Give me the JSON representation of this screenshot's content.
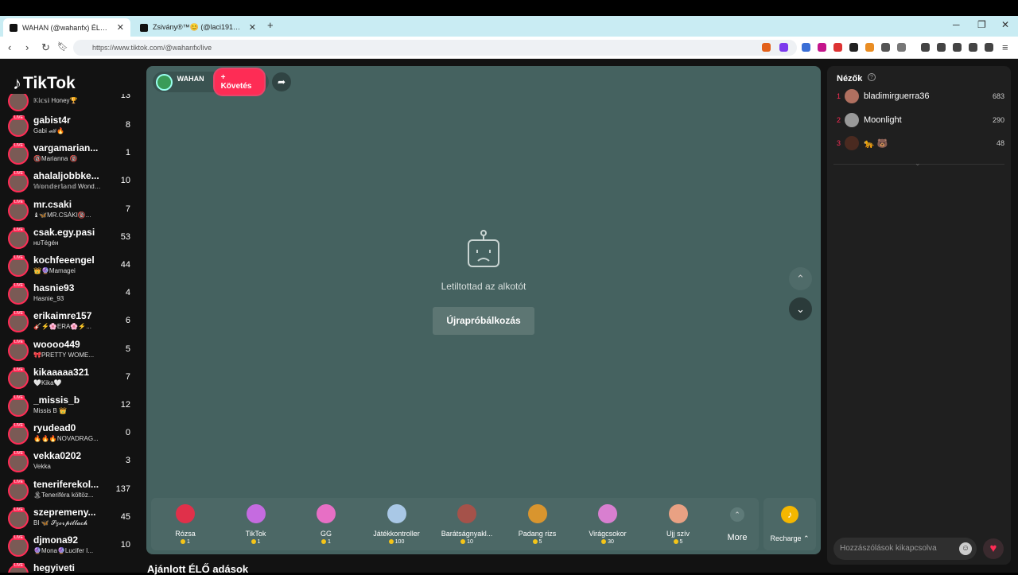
{
  "browser": {
    "tabs": [
      {
        "title": "WAHAN (@wahanfx) ÉLŐ adásb",
        "close": "✕"
      },
      {
        "title": "Zsivány®™😊 (@laci1910) ÉLŐ a",
        "close": "✕"
      }
    ],
    "new_tab": "+",
    "url": "https://www.tiktok.com/@wahanfx/live"
  },
  "brand": "TikTok",
  "sidebar": {
    "partial_top": {
      "sub": "𝕂𝕚𝕔𝕤𝕚 Honey🏆",
      "count": "13"
    },
    "items": [
      {
        "name": "gabist4r",
        "sub": "Gabi 🏎🔥",
        "count": "8"
      },
      {
        "name": "vargamarian...",
        "sub": "🔞Marianna 🔞",
        "count": "1"
      },
      {
        "name": "ahalaljobbke...",
        "sub": "𝕎𝕠𝕟𝕕𝕖𝕣𝕝𝕒𝕟𝕕 Wonderland_...",
        "count": "10"
      },
      {
        "name": "mr.csaki",
        "sub": "♝🦋MR.CSÁKI🔞...",
        "count": "7"
      },
      {
        "name": "csak.egy.pasi",
        "sub": "ʜᴜTégéʜ",
        "count": "53"
      },
      {
        "name": "kochfeeengel",
        "sub": "👑🔮Mamagei",
        "count": "44"
      },
      {
        "name": "hasnie93",
        "sub": "Hasnie_93",
        "count": "4"
      },
      {
        "name": "erikaimre157",
        "sub": "🎸⚡🌸ERA🌸⚡...",
        "count": "6"
      },
      {
        "name": "woooo449",
        "sub": "🎀PRETTY WOME...",
        "count": "5"
      },
      {
        "name": "kikaaaaa321",
        "sub": "🤍Kika🤍",
        "count": "7"
      },
      {
        "name": "_missis_b",
        "sub": "Missis B 👑",
        "count": "12"
      },
      {
        "name": "ryudead0",
        "sub": "🔥🔥🔥NOVADRAG...",
        "count": "0"
      },
      {
        "name": "vekka0202",
        "sub": "Vekka",
        "count": "3"
      },
      {
        "name": "teneriferekol...",
        "sub": "🏝Teneriféra költöz...",
        "count": "137"
      },
      {
        "name": "szepremeny...",
        "sub": "BI 🦋 𝓢𝔃𝓸𝓻𝓹𝓲𝓵𝓵𝓪𝓬𝓱",
        "count": "45"
      },
      {
        "name": "djmona92",
        "sub": "🔮Mona🔮Lucifer I...",
        "count": "10"
      },
      {
        "name": "hegyiveti",
        "sub": "",
        "count": ""
      }
    ]
  },
  "player": {
    "host_name": "WAHAN",
    "follow_label": "+ Követés",
    "message": "Letiltottad az alkotót",
    "retry_label": "Újrapróbálkozás",
    "up_icon": "⌃",
    "down_icon": "⌄"
  },
  "gifts": [
    {
      "name": "Rózsa",
      "price": "1",
      "color": "#e0304a"
    },
    {
      "name": "TikTok",
      "price": "1",
      "color": "#c56be0"
    },
    {
      "name": "GG",
      "price": "1",
      "color": "#e76fc5"
    },
    {
      "name": "Játékkontroller",
      "price": "100",
      "color": "#a9c8e6"
    },
    {
      "name": "Barátságnyakl...",
      "price": "10",
      "color": "#a5524a"
    },
    {
      "name": "Padang rizs",
      "price": "5",
      "color": "#d9952e"
    },
    {
      "name": "Virágcsokor",
      "price": "30",
      "color": "#d87fd0"
    },
    {
      "name": "Ujj szív",
      "price": "5",
      "color": "#e9a183"
    }
  ],
  "more_label": "More",
  "recharge_label": "Recharge ⌃",
  "recommended_title": "Ajánlott ÉLŐ adások",
  "viewers": {
    "title": "Nézők",
    "list": [
      {
        "rank": "1",
        "name": "bladimirguerra36",
        "count": "683",
        "color": "#b07060"
      },
      {
        "rank": "2",
        "name": "Moonlight",
        "count": "290",
        "color": "#999"
      },
      {
        "rank": "3",
        "name": "🐆 🐻",
        "count": "48",
        "color": "#4a2a20"
      }
    ]
  },
  "chat": {
    "placeholder": "Hozzászólások kikapcsolva"
  }
}
